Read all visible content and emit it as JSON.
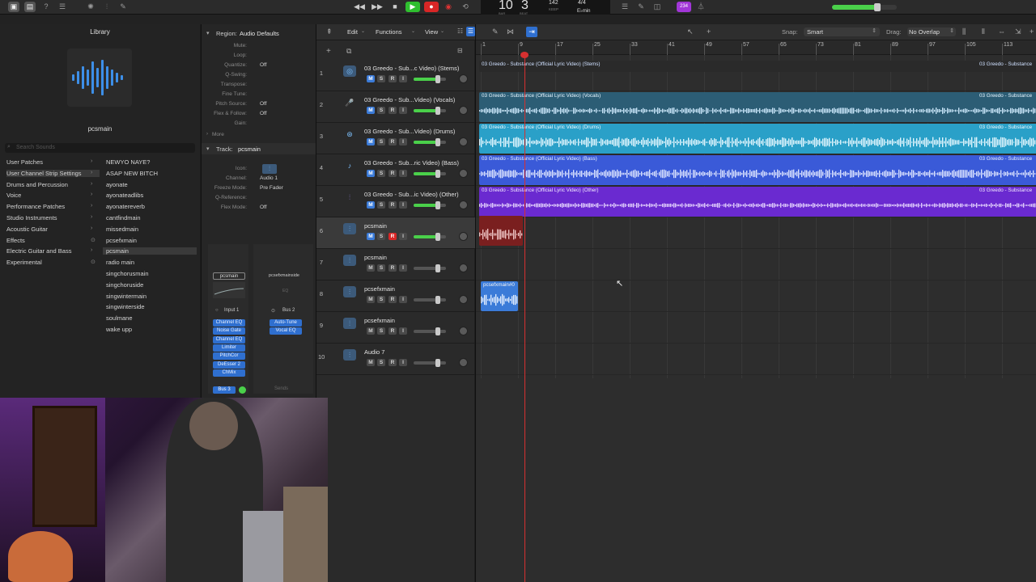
{
  "lcd": {
    "bars": "10",
    "beat": "3",
    "bar_label": "BAR",
    "beat_label": "BEAT",
    "tempo": "142",
    "tempo_label": "KEEP",
    "signature": "4/4",
    "key": "E♭min"
  },
  "badge": {
    "count": "234"
  },
  "library": {
    "title": "Library",
    "patch_name": "pcsmain",
    "search_placeholder": "Search Sounds",
    "categories": [
      "User Patches",
      "User Channel Strip Settings",
      "Drums and Percussion",
      "Voice",
      "Performance Patches",
      "Studio Instruments",
      "Acoustic Guitar",
      "Effects",
      "Electric Guitar and Bass",
      "Experimental"
    ],
    "patches": [
      "NEWYO NAYE?",
      "ASAP NEW BITCH",
      "ayonate",
      "ayonateadlibs",
      "ayonatereverb",
      "cantfindmain",
      "missedmain",
      "pcsefxmain",
      "pcsmain",
      "radio main",
      "singchorusmain",
      "singchoruside",
      "singwintermain",
      "singwinterside",
      "soulmane",
      "wake upp"
    ]
  },
  "inspector": {
    "region_label": "Region:",
    "region_value": "Audio Defaults",
    "params": [
      {
        "label": "Mute:",
        "value": ""
      },
      {
        "label": "Loop:",
        "value": ""
      },
      {
        "label": "Quantize:",
        "value": "Off"
      },
      {
        "label": "Q-Swing:",
        "value": ""
      },
      {
        "label": "Transpose:",
        "value": ""
      },
      {
        "label": "Fine Tune:",
        "value": ""
      },
      {
        "label": "Pitch Source:",
        "value": "Off"
      },
      {
        "label": "Flex & Follow:",
        "value": "Off"
      },
      {
        "label": "Gain:",
        "value": ""
      }
    ],
    "more_label": "More",
    "track_label": "Track:",
    "track_value": "pcsmain",
    "track_params": [
      {
        "label": "Icon:",
        "value": ""
      },
      {
        "label": "Channel:",
        "value": "Audio 1"
      },
      {
        "label": "Freeze Mode:",
        "value": "Pre Fader"
      },
      {
        "label": "Q-Reference:",
        "value": ""
      },
      {
        "label": "Flex Mode:",
        "value": "Off"
      }
    ],
    "strip1": {
      "name": "pcsmain",
      "input": "Input 1",
      "plugins": [
        "Channel EQ",
        "Noise Gate",
        "Channel EQ",
        "Limiter",
        "PitchCor",
        "DeEsser 2",
        "ChMix"
      ],
      "bus": "Bus 3"
    },
    "strip2": {
      "name": "pcsefxmainside",
      "eq": "EQ",
      "output": "Bus 2",
      "plugins": [
        "Auto-Tune",
        "Vocal EQ"
      ],
      "sends": "Sends"
    }
  },
  "toolbar": {
    "edit": "Edit",
    "functions": "Functions",
    "view": "View",
    "snap_label": "Snap:",
    "snap_value": "Smart",
    "drag_label": "Drag:",
    "drag_value": "No Overlap"
  },
  "ruler": [
    "1",
    "9",
    "17",
    "25",
    "33",
    "41",
    "49",
    "57",
    "65",
    "73",
    "81",
    "89",
    "97",
    "105",
    "113"
  ],
  "tracks": [
    {
      "num": "1",
      "name": "03 Greedo - Sub...c Video) (Stems)",
      "icon": "stems-icon",
      "rec": false
    },
    {
      "num": "2",
      "name": "03 Greedo - Sub...Video) (Vocals)",
      "icon": "microphone-icon",
      "rec": false
    },
    {
      "num": "3",
      "name": "03 Greedo - Sub...Video) (Drums)",
      "icon": "drums-icon",
      "rec": false
    },
    {
      "num": "4",
      "name": "03 Greedo - Sub...ric Video) (Bass)",
      "icon": "bass-icon",
      "rec": false
    },
    {
      "num": "5",
      "name": "03 Greedo - Sub...ic Video) (Other)",
      "icon": "waveform-icon",
      "rec": false
    },
    {
      "num": "6",
      "name": "pcsmain",
      "icon": "waveform-icon",
      "rec": true
    },
    {
      "num": "7",
      "name": "pcsmain",
      "icon": "waveform-icon",
      "rec": false
    },
    {
      "num": "8",
      "name": "pcsefxmain",
      "icon": "waveform-icon",
      "rec": false
    },
    {
      "num": "9",
      "name": "pcsefxmain",
      "icon": "waveform-icon",
      "rec": false
    },
    {
      "num": "10",
      "name": "Audio 7",
      "icon": "waveform-icon",
      "rec": false
    }
  ],
  "regions": {
    "stems": "03 Greedo - Substance (Official Lyric Video) (Stems)",
    "stems_right": "03 Greedo - Substance",
    "vocals": "03 Greedo - Substance (Official Lyric Video) (Vocals)",
    "vocals_right": "03 Greedo - Substance",
    "drums": "03 Greedo - Substance (Official Lyric Video) (Drums)",
    "drums_right": "03 Greedo - Substance",
    "bass": "03 Greedo - Substance (Official Lyric Video) (Bass)",
    "bass_right": "03 Greedo - Substance",
    "other": "03 Greedo - Substance (Official Lyric Video) (Other)",
    "other_right": "03 Greedo - Substance",
    "pcsefx": "pcsefxmain#0"
  }
}
